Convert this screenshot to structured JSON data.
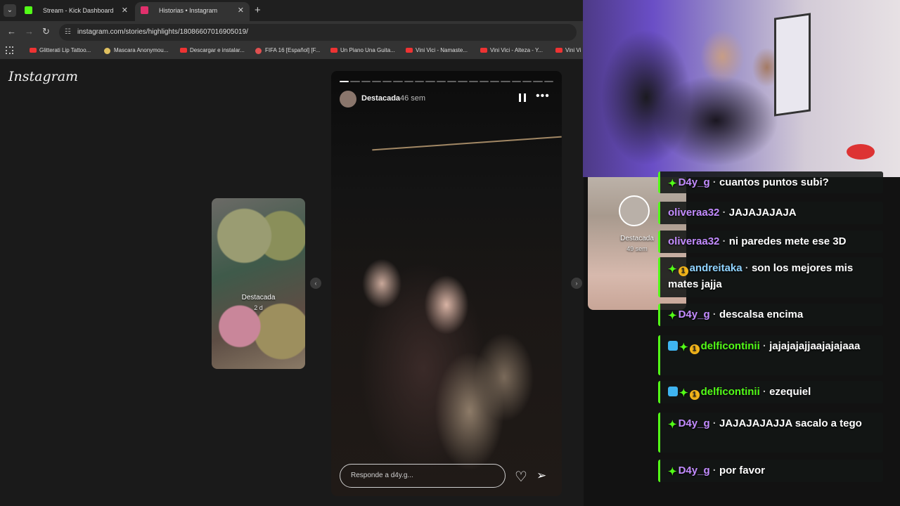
{
  "browser": {
    "tabs": [
      {
        "title": "Stream - Kick Dashboard",
        "favicon_color": "#53fc18",
        "active": false
      },
      {
        "title": "Historias • Instagram",
        "favicon_color": "#e1306c",
        "active": true
      }
    ],
    "url": "instagram.com/stories/highlights/18086607016905019/",
    "bookmarks": [
      {
        "label": "Glitterati Lip Tattoo...",
        "icon": "youtube-icon"
      },
      {
        "label": "Mascara Anonymou...",
        "icon": "site-icon"
      },
      {
        "label": "Descargar e instalar...",
        "icon": "youtube-icon"
      },
      {
        "label": "FIFA 16 [Español] [F...",
        "icon": "site-icon"
      },
      {
        "label": "Un Piano Una Guita...",
        "icon": "youtube-icon"
      },
      {
        "label": "Vini Vici - Namaste...",
        "icon": "youtube-icon"
      },
      {
        "label": "Vini Vici - Alteza - Y...",
        "icon": "youtube-icon"
      },
      {
        "label": "Vini Vi",
        "icon": "youtube-icon"
      }
    ]
  },
  "instagram": {
    "logo": "Instagram",
    "left_highlight": {
      "label": "Destacada",
      "age": "2 d"
    },
    "right_highlight": {
      "label": "Destacada",
      "age": "49 sem",
      "overlay_label": "Destacada",
      "overlay_age": "46 sem"
    },
    "story": {
      "author": "Destacada",
      "time": "46 sem",
      "segments_total": 20,
      "segment_active": 1,
      "reply_placeholder": "Responde a d4y.g...",
      "more_label": "•••"
    }
  },
  "chat": {
    "accent": "#53fc18",
    "messages": [
      {
        "user": "D4y_g",
        "user_color": "#c38cff",
        "badges": [
          "green"
        ],
        "text": "cuantos puntos subi?"
      },
      {
        "user": "oliveraa32",
        "user_color": "#c38cff",
        "badges": [],
        "text": "JAJAJAJAJA"
      },
      {
        "user": "oliveraa32",
        "user_color": "#c38cff",
        "badges": [],
        "text": "ni paredes mete ese 3D"
      },
      {
        "user": "andreitaka",
        "user_color": "#8fd3ff",
        "badges": [
          "green",
          "gold"
        ],
        "text": "son los mejores mis mates jajja"
      },
      {
        "user": "D4y_g",
        "user_color": "#c38cff",
        "badges": [
          "green"
        ],
        "text": "descalsa encima"
      },
      {
        "user": "delficontinii",
        "user_color": "#53fc18",
        "badges": [
          "blue",
          "green",
          "gold"
        ],
        "text": "jajajajajjaajajajaaa"
      },
      {
        "user": "delficontinii",
        "user_color": "#53fc18",
        "badges": [
          "blue",
          "green",
          "gold"
        ],
        "text": "ezequiel"
      },
      {
        "user": "D4y_g",
        "user_color": "#c38cff",
        "badges": [
          "green"
        ],
        "text": "JAJAJAJAJJA sacalo a tego"
      },
      {
        "user": "D4y_g",
        "user_color": "#c38cff",
        "badges": [
          "green"
        ],
        "text": "por favor"
      }
    ]
  }
}
